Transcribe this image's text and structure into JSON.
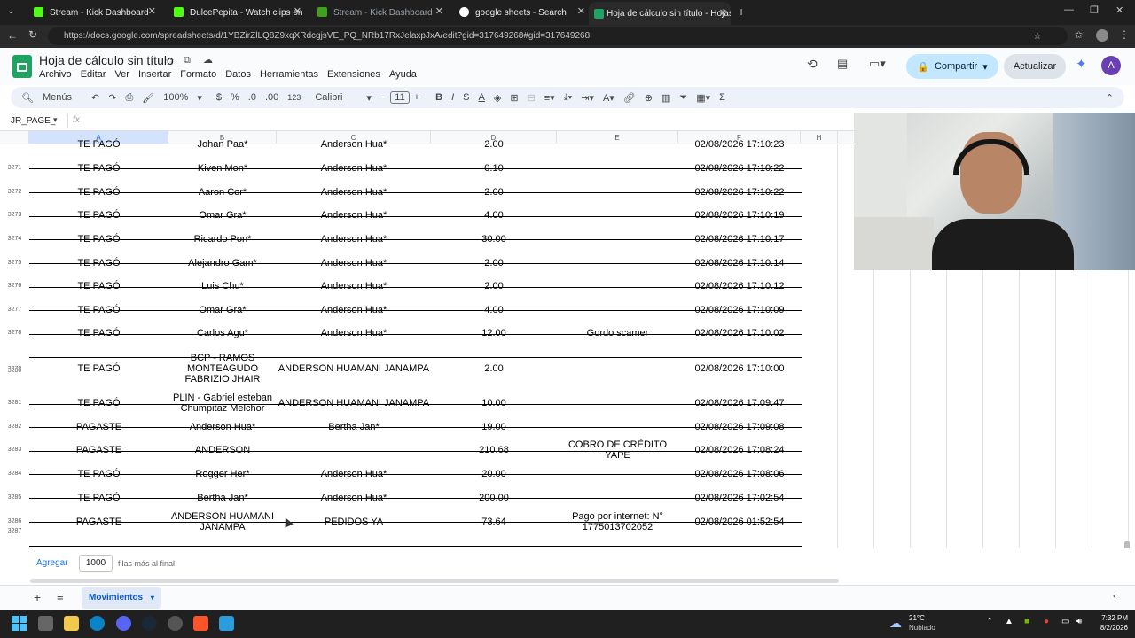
{
  "browser": {
    "tabs": [
      {
        "title": "Stream - Kick Dashboard",
        "active": false
      },
      {
        "title": "DulcePepita - Watch clips on Kick",
        "active": false
      },
      {
        "title": "Stream - Kick Dashboard",
        "active": false
      },
      {
        "title": "google sheets - Search",
        "active": false
      },
      {
        "title": "Hoja de cálculo sin título - Hojas d",
        "active": true
      }
    ],
    "url": "https://docs.google.com/spreadsheets/d/1YBZirZlLQ8Z9xqXRdcgjsVE_PQ_NRb17RxJelaxpJxA/edit?gid=317649268#gid=317649268"
  },
  "app": {
    "doc_title": "Hoja de cálculo sin título",
    "menu": [
      "Archivo",
      "Editar",
      "Ver",
      "Insertar",
      "Formato",
      "Datos",
      "Herramientas",
      "Extensiones",
      "Ayuda"
    ],
    "share_label": "Compartir",
    "update_label": "Actualizar",
    "avatar_letter": "A"
  },
  "toolbar": {
    "menus_label": "Menús",
    "zoom": "100%",
    "currency": "$",
    "percent": "%",
    "dec_less": ".0",
    "dec_more": ".00",
    "format_123": "123",
    "font": "Calibri",
    "font_size": "11",
    "bold": "B",
    "italic": "I",
    "strike": "S",
    "text_color": "A",
    "sum": "Σ"
  },
  "formula_bar": {
    "name_box": "JR_PAGE_",
    "fx": "fx"
  },
  "columns": [
    "A",
    "B",
    "C",
    "D",
    "E",
    "F",
    "H"
  ],
  "rows": [
    {
      "num": "",
      "a": "TE PAGÓ",
      "b": "Johan Paa*",
      "c": "Anderson Hua*",
      "d": "2.00",
      "e": "",
      "f": "02/08/2026 17:10:23"
    },
    {
      "num": "3271",
      "a": "TE PAGÓ",
      "b": "Kiven Mon*",
      "c": "Anderson Hua*",
      "d": "0.10",
      "e": "",
      "f": "02/08/2026 17:10:22"
    },
    {
      "num": "3272",
      "a": "TE PAGÓ",
      "b": "Aaron Cor*",
      "c": "Anderson Hua*",
      "d": "2.00",
      "e": "",
      "f": "02/08/2026 17:10:22"
    },
    {
      "num": "3273",
      "a": "TE PAGÓ",
      "b": "Omar Gra*",
      "c": "Anderson Hua*",
      "d": "4.00",
      "e": "",
      "f": "02/08/2026 17:10:19"
    },
    {
      "num": "3274",
      "a": "TE PAGÓ",
      "b": "Ricardo Pon*",
      "c": "Anderson Hua*",
      "d": "30.00",
      "e": "",
      "f": "02/08/2026 17:10:17"
    },
    {
      "num": "3275",
      "a": "TE PAGÓ",
      "b": "Alejandro Gam*",
      "c": "Anderson Hua*",
      "d": "2.00",
      "e": "",
      "f": "02/08/2026 17:10:14"
    },
    {
      "num": "3276",
      "a": "TE PAGÓ",
      "b": "Luis Chu*",
      "c": "Anderson Hua*",
      "d": "2.00",
      "e": "",
      "f": "02/08/2026 17:10:12"
    },
    {
      "num": "3277",
      "a": "TE PAGÓ",
      "b": "Omar Gra*",
      "c": "Anderson Hua*",
      "d": "4.00",
      "e": "",
      "f": "02/08/2026 17:10:09"
    },
    {
      "num": "3278",
      "a": "TE PAGÓ",
      "b": "Carlos Agu*",
      "c": "Anderson Hua*",
      "d": "12.00",
      "e": "Gordo scamer",
      "f": "02/08/2026 17:10:02"
    },
    {
      "num": "3279",
      "a": "TE PAGÓ",
      "b": "BCP - RAMOS MONTEAGUDO FABRIZIO JHAIR",
      "c": "ANDERSON HUAMANI JANAMPA",
      "d": "2.00",
      "e": "",
      "f": "02/08/2026 17:10:00"
    },
    {
      "num": "3281",
      "a": "TE PAGÓ",
      "b": "PLIN - Gabriel esteban Chumpitaz Melchor",
      "c": "ANDERSON HUAMANI JANAMPA",
      "d": "10.00",
      "e": "",
      "f": "02/08/2026 17:09:47"
    },
    {
      "num": "3282",
      "a": "PAGASTE",
      "b": "Anderson Hua*",
      "c": "Bertha Jan*",
      "d": "19.00",
      "e": "",
      "f": "02/08/2026 17:09:08"
    },
    {
      "num": "3283",
      "a": "PAGASTE",
      "b": "ANDERSON",
      "c": "",
      "d": "210.68",
      "e": "COBRO DE CRÉDITO YAPE",
      "f": "02/08/2026 17:08:24"
    },
    {
      "num": "3284",
      "a": "TE PAGÓ",
      "b": "Rogger Her*",
      "c": "Anderson Hua*",
      "d": "20.00",
      "e": "",
      "f": "02/08/2026 17:08:06"
    },
    {
      "num": "3285",
      "a": "TE PAGÓ",
      "b": "Bertha Jan*",
      "c": "Anderson Hua*",
      "d": "200.00",
      "e": "",
      "f": "02/08/2026 17:02:54"
    },
    {
      "num": "3286",
      "a": "PAGASTE",
      "b": "ANDERSON HUAMANI JANAMPA",
      "c": "PEDIDOS YA",
      "d": "73.64",
      "e": "Pago por internet: N° 1775013702052",
      "f": "02/08/2026 01:52:54"
    }
  ],
  "row_3280_label": "3280",
  "row_3287_label": "3287",
  "add_rows": {
    "button": "Agregar",
    "count": "1000",
    "suffix": "filas más al final"
  },
  "sheet_tab": "Movimientos",
  "taskbar": {
    "weather_temp": "21°C",
    "weather_desc": "Nublado",
    "time": "7:32 PM",
    "date": "8/2/2026"
  }
}
